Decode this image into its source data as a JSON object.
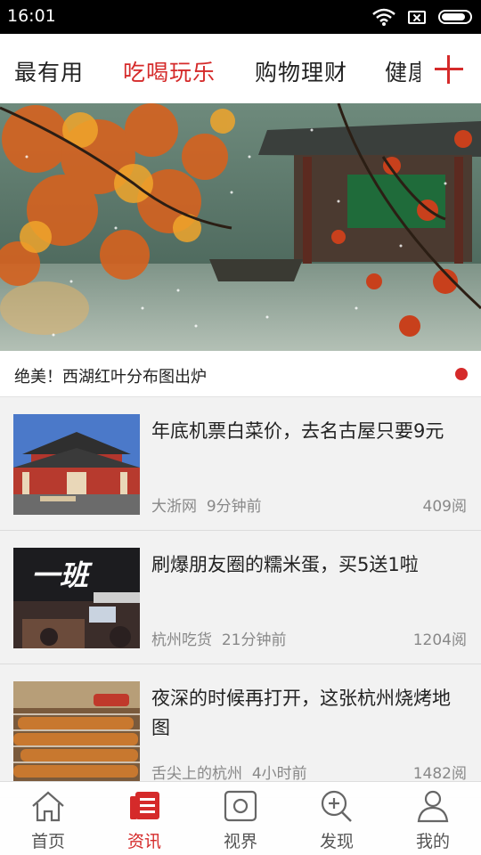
{
  "status_bar": {
    "time": "16:01"
  },
  "tabs": [
    {
      "label": "最有用"
    },
    {
      "label": "吃喝玩乐"
    },
    {
      "label": "购物理财"
    },
    {
      "label": "健康"
    }
  ],
  "active_tab_index": 1,
  "banner": {
    "caption": "绝美！西湖红叶分布图出炉"
  },
  "articles": [
    {
      "title": "年底机票白菜价，去名古屋只要9元",
      "source": "大浙网",
      "time": "9分钟前",
      "reads": "409阅"
    },
    {
      "title": "刷爆朋友圈的糯米蛋，买5送1啦",
      "source": "杭州吃货",
      "time": "21分钟前",
      "reads": "1204阅",
      "thumb_text": "一班"
    },
    {
      "title": "夜深的时候再打开，这张杭州烧烤地图",
      "source": "舌尖上的杭州",
      "time": "4小时前",
      "reads": "1482阅"
    }
  ],
  "bottom_nav": [
    {
      "label": "首页",
      "icon": "home-icon"
    },
    {
      "label": "资讯",
      "icon": "news-icon",
      "active": true
    },
    {
      "label": "视界",
      "icon": "camera-icon"
    },
    {
      "label": "发现",
      "icon": "discover-search-icon"
    },
    {
      "label": "我的",
      "icon": "profile-icon"
    }
  ],
  "colors": {
    "accent": "#d52a2a",
    "background": "#f2f2f2",
    "status_bar": "#000000"
  }
}
